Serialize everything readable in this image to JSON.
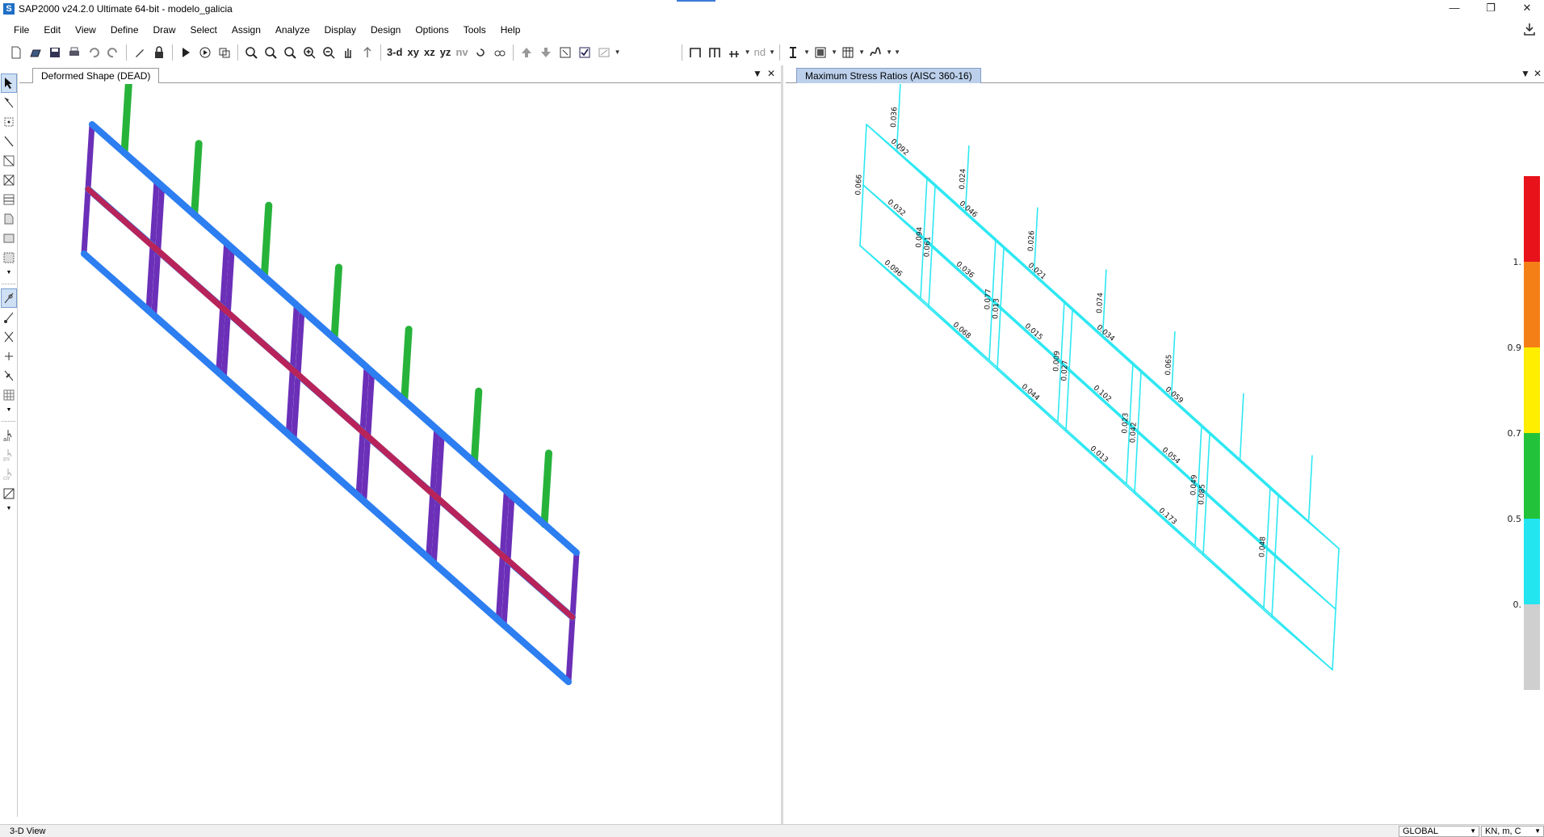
{
  "window": {
    "title": "SAP2000 v24.2.0 Ultimate 64-bit - modelo_galicia",
    "icon_letter": "S",
    "min_glyph": "—",
    "restore_glyph": "❐",
    "close_glyph": "✕"
  },
  "menu": [
    "File",
    "Edit",
    "View",
    "Define",
    "Draw",
    "Select",
    "Assign",
    "Analyze",
    "Display",
    "Design",
    "Options",
    "Tools",
    "Help"
  ],
  "toolbar": {
    "view_3d": "3-d",
    "view_xy": "xy",
    "view_xz": "xz",
    "view_yz": "yz",
    "view_nv": "nv",
    "nd": "nd"
  },
  "left_window": {
    "tab": "Deformed Shape (DEAD)",
    "pin_glyph": "▼",
    "close_glyph": "✕"
  },
  "right_window": {
    "tab": "Maximum Stress Ratios  (AISC 360-16)",
    "pin_glyph": "▼",
    "close_glyph": "✕",
    "legend": {
      "labels": [
        "1.",
        "0.9",
        "0.7",
        "0.5",
        "0."
      ],
      "colors": [
        "#e8121b",
        "#f57f17",
        "#ffee00",
        "#22c33a",
        "#22e5f0",
        "#cfcfcf"
      ]
    },
    "ratios": [
      "0.066",
      "0.094",
      "0.092",
      "0.096",
      "0.032",
      "0.036",
      "0.061",
      "0.077",
      "0.046",
      "0.068",
      "0.036",
      "0.024",
      "0.013",
      "0.009",
      "0.021",
      "0.044",
      "0.015",
      "0.026",
      "0.027",
      "0.023",
      "0.034",
      "0.013",
      "0.102",
      "0.074",
      "0.042",
      "0.049",
      "0.059",
      "0.173",
      "0.054",
      "0.065",
      "0.085",
      "0.048"
    ]
  },
  "status": {
    "left": "3-D View",
    "coord_system": "GLOBAL",
    "units": "KN, m, C"
  },
  "colors": {
    "frame_blue": "#2d7ef0",
    "frame_purple": "#6b2fb8",
    "frame_crimson": "#b8245a",
    "frame_green": "#27b33a",
    "frame_cyan": "#2ee8f2"
  }
}
